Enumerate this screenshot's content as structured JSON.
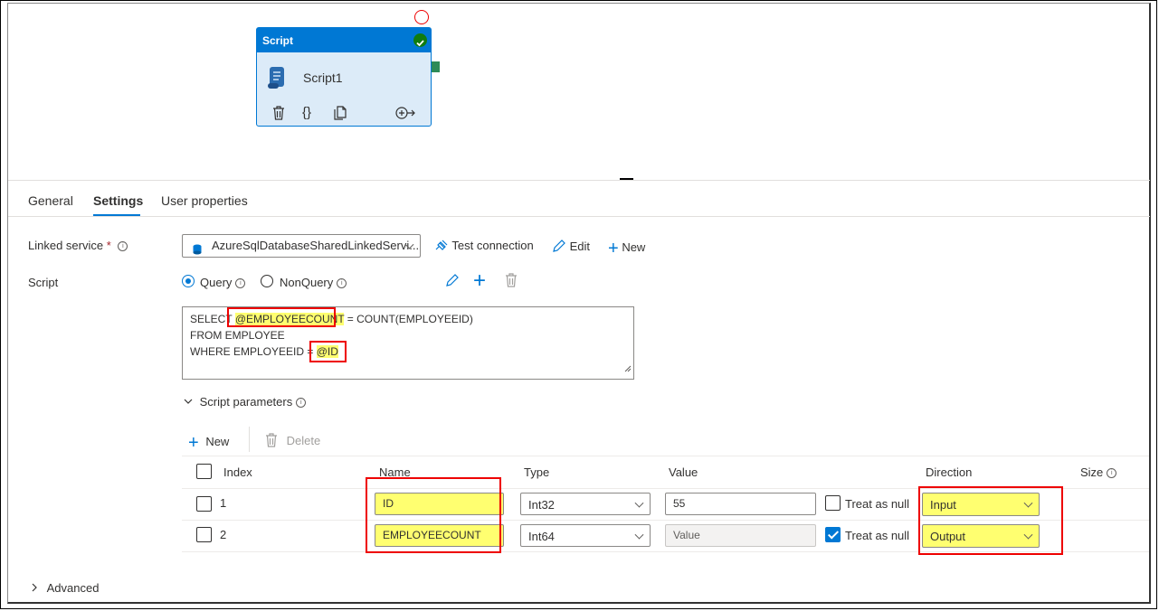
{
  "activity": {
    "type_label": "Script",
    "name": "Script1",
    "icons": [
      "delete-icon",
      "code-icon",
      "copy-icon",
      "add-output-icon"
    ]
  },
  "tabs": [
    {
      "label": "General"
    },
    {
      "label": "Settings"
    },
    {
      "label": "User properties"
    }
  ],
  "linked_service": {
    "label": "Linked service",
    "required_mark": "*",
    "value": "AzureSqlDatabaseSharedLinkedServi...",
    "test_connection": "Test connection",
    "edit": "Edit",
    "new": "New"
  },
  "script": {
    "label": "Script",
    "query_label": "Query",
    "nonquery_label": "NonQuery",
    "selected": "Query",
    "lines": {
      "l1_pre": "SELECT ",
      "l1_var": "@EMPLOYEECOUNT",
      "l1_post": " = COUNT(EMPLOYEEID)",
      "l2": "FROM EMPLOYEE",
      "l3_pre": "WHERE EMPLOYEEID = ",
      "l3_var": "@ID"
    }
  },
  "params": {
    "section_label": "Script parameters",
    "new_label": "New",
    "delete_label": "Delete",
    "headers": {
      "index": "Index",
      "name": "Name",
      "type": "Type",
      "value": "Value",
      "direction": "Direction",
      "size": "Size"
    },
    "rows": [
      {
        "index": "1",
        "name": "ID",
        "type": "Int32",
        "value": "55",
        "treat_as_null": false,
        "treat_label": "Treat as null",
        "direction": "Input"
      },
      {
        "index": "2",
        "name": "EMPLOYEECOUNT",
        "type": "Int64",
        "value_placeholder": "Value",
        "treat_as_null": true,
        "treat_label": "Treat as null",
        "direction": "Output"
      }
    ]
  },
  "advanced_label": "Advanced",
  "colors": {
    "accent": "#0078d4",
    "highlight": "#ffff70",
    "annotation_red": "#e00000",
    "success": "#107c10"
  }
}
